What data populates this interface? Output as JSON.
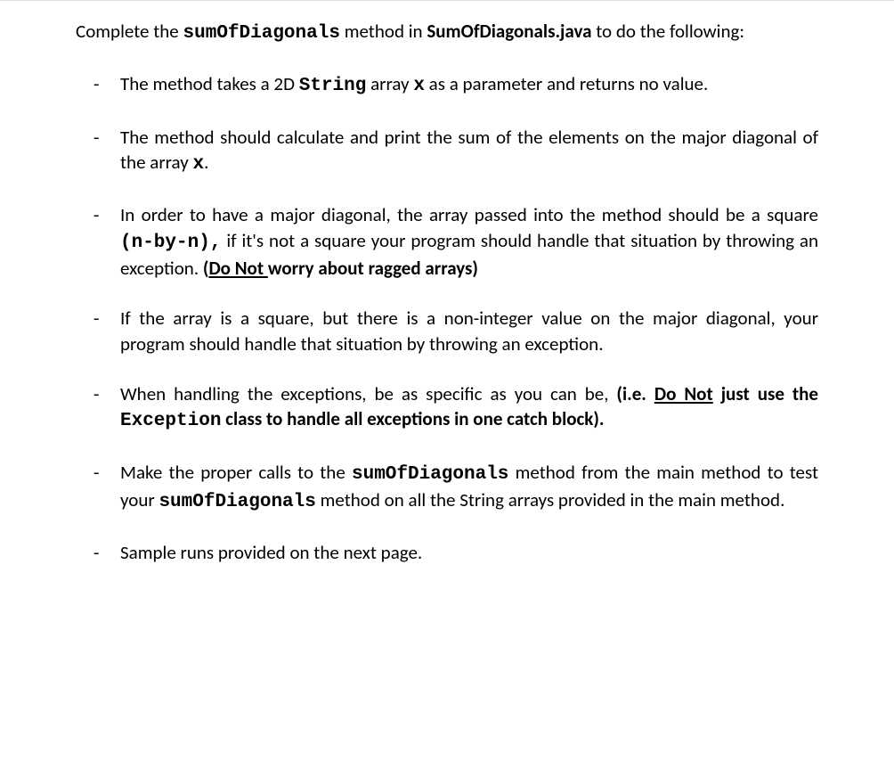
{
  "intro": {
    "pre": "Complete the ",
    "method": "sumOfDiagonals",
    "mid": " method in ",
    "file": "SumOfDiagonals.java",
    "post": " to do the following:"
  },
  "items": [
    {
      "parts": [
        {
          "text": "The method takes a 2D "
        },
        {
          "text": "String",
          "bold": true,
          "mono": true
        },
        {
          "text": " array "
        },
        {
          "text": "x",
          "bold": true,
          "mono": true
        },
        {
          "text": " as a parameter and returns no value."
        }
      ]
    },
    {
      "parts": [
        {
          "text": "The method should calculate and print the sum of the elements on the major diagonal of the array "
        },
        {
          "text": "x",
          "bold": true,
          "mono": true
        },
        {
          "text": "."
        }
      ]
    },
    {
      "parts": [
        {
          "text": "In order to have a major diagonal, the array passed into the method should be a square "
        },
        {
          "text": "(n-by-n),",
          "bold": true,
          "mono": true
        },
        {
          "text": " if it's not a square your program should handle that situation by throwing an exception. "
        },
        {
          "text": "(",
          "bold": true
        },
        {
          "text": "Do Not ",
          "bold": true,
          "underline": true
        },
        {
          "text": "worry about ragged arrays)",
          "bold": true
        }
      ]
    },
    {
      "parts": [
        {
          "text": "If the array is a square, but there is a non-integer value on the major diagonal, your program should handle that situation by throwing an exception."
        }
      ]
    },
    {
      "parts": [
        {
          "text": "When handling the exceptions, be as specific as you can be, "
        },
        {
          "text": "(i.e. ",
          "bold": true
        },
        {
          "text": "Do Not",
          "bold": true,
          "underline": true
        },
        {
          "text": " just use the ",
          "bold": true
        },
        {
          "text": "Exception",
          "bold": true,
          "mono": true
        },
        {
          "text": " class to handle all exceptions in one catch block).",
          "bold": true
        }
      ]
    },
    {
      "parts": [
        {
          "text": "Make the proper calls to the "
        },
        {
          "text": "sumOfDiagonals",
          "bold": true,
          "mono": true
        },
        {
          "text": " method from the main method to test your "
        },
        {
          "text": "sumOfDiagonals",
          "bold": true,
          "mono": true
        },
        {
          "text": " method on all the String arrays provided in the main method."
        }
      ]
    },
    {
      "parts": [
        {
          "text": "Sample runs provided on the next page."
        }
      ]
    }
  ]
}
